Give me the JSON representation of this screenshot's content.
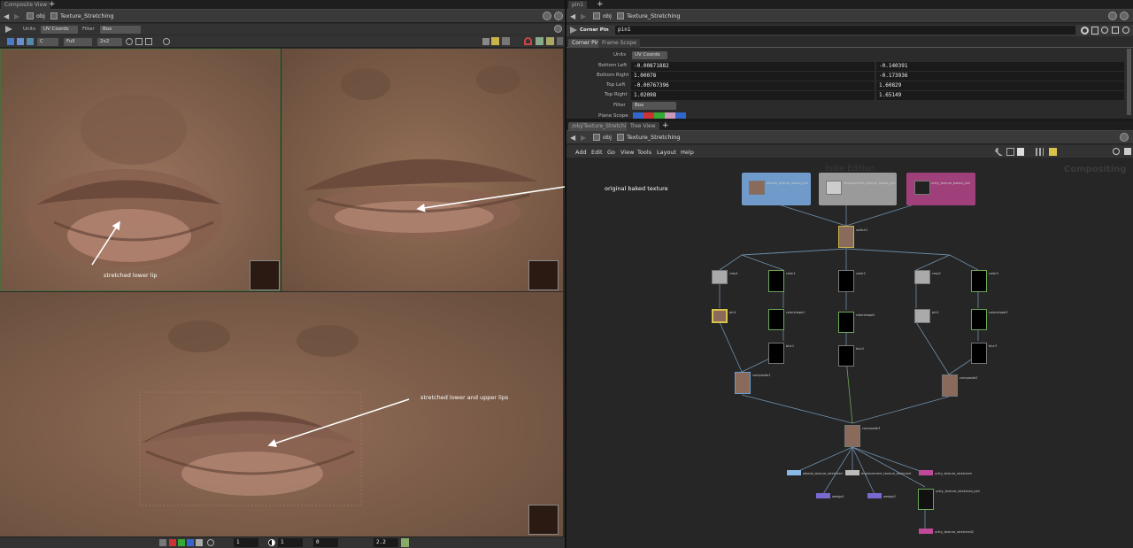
{
  "left": {
    "tab": "Composite View",
    "path": [
      "obj",
      "Texture_Stretching"
    ],
    "toolbar": {
      "units_label": "Units",
      "units_value": "UV Coords",
      "filter_label": "Filter",
      "filter_value": "Box",
      "channel_value": "C",
      "res_value": "Full",
      "split_value": "2x2"
    },
    "annotations": {
      "a1": "stretched lower lip",
      "a2": "original baked texture",
      "a3": "stretched lower and upper lips"
    },
    "bottom": {
      "frame": "1",
      "gamma_a": "1",
      "exposure": "0",
      "gamma": "2.2"
    }
  },
  "right": {
    "tab": "pin1",
    "path": [
      "obj",
      "Texture_Stretching"
    ],
    "node_type": "Corner Pin",
    "node_name": "pin1",
    "ptabs": [
      "Corner Pin",
      "Frame Scope"
    ],
    "units_label": "Units",
    "units_value": "UV Coords",
    "params": [
      {
        "label": "Bottom Left",
        "x": "-0.00871882",
        "y": "-0.140391"
      },
      {
        "label": "Bottom Right",
        "x": "1.00078",
        "y": "-0.173936"
      },
      {
        "label": "Top Left",
        "x": "-0.00767396",
        "y": "1.60829"
      },
      {
        "label": "Top Right",
        "x": "1.02098",
        "y": "1.65149"
      }
    ],
    "filter_label": "Filter",
    "filter_value": "Box",
    "scope_label": "Plane Scope"
  },
  "network": {
    "tabs": [
      "/obj/Texture_Stretching",
      "Tree View"
    ],
    "path": [
      "obj",
      "Texture_Stretching"
    ],
    "menu": [
      "Add",
      "Edit",
      "Go",
      "View",
      "Tools",
      "Layout",
      "Help"
    ],
    "watermark_edition": "Indie Edition",
    "watermark_context": "Compositing",
    "node_labels": {
      "albedo": "albedo_texture_baked_pict",
      "disp": "displacement_texture_baked_pict",
      "unity": "unity_texture_baked_pict",
      "switch": "switch1",
      "crop1": "crop1",
      "color1": "color1",
      "color2": "color2",
      "crop2": "crop2",
      "color3": "color3",
      "pin1": "pin1",
      "colorshape1": "colorshape1",
      "colorshape2": "colorshape2",
      "pin2": "pin2",
      "colorshape3": "colorshape3",
      "blur1": "blur1",
      "blur2": "blur2",
      "blur3": "blur3",
      "composite1": "composite1",
      "composite2": "composite2",
      "composite3": "composite3",
      "out_albedo": "albedo_texture_stretched",
      "out_disp": "displacement_texture_stretched",
      "out_unity": "unity_texture_stretched",
      "wedge1": "wedge1",
      "wedge2": "wedge2",
      "unity_pict": "unity_texture_stretched_pict",
      "unity_final": "unity_texture_stretched2"
    }
  },
  "colors": {
    "skin": "#8a6652",
    "lip": "#b07a6a",
    "arrow": "#ffffff",
    "albedo_box": "#6f9ac9",
    "disp_box": "#9a9a9a",
    "unity_box": "#a0407a"
  }
}
